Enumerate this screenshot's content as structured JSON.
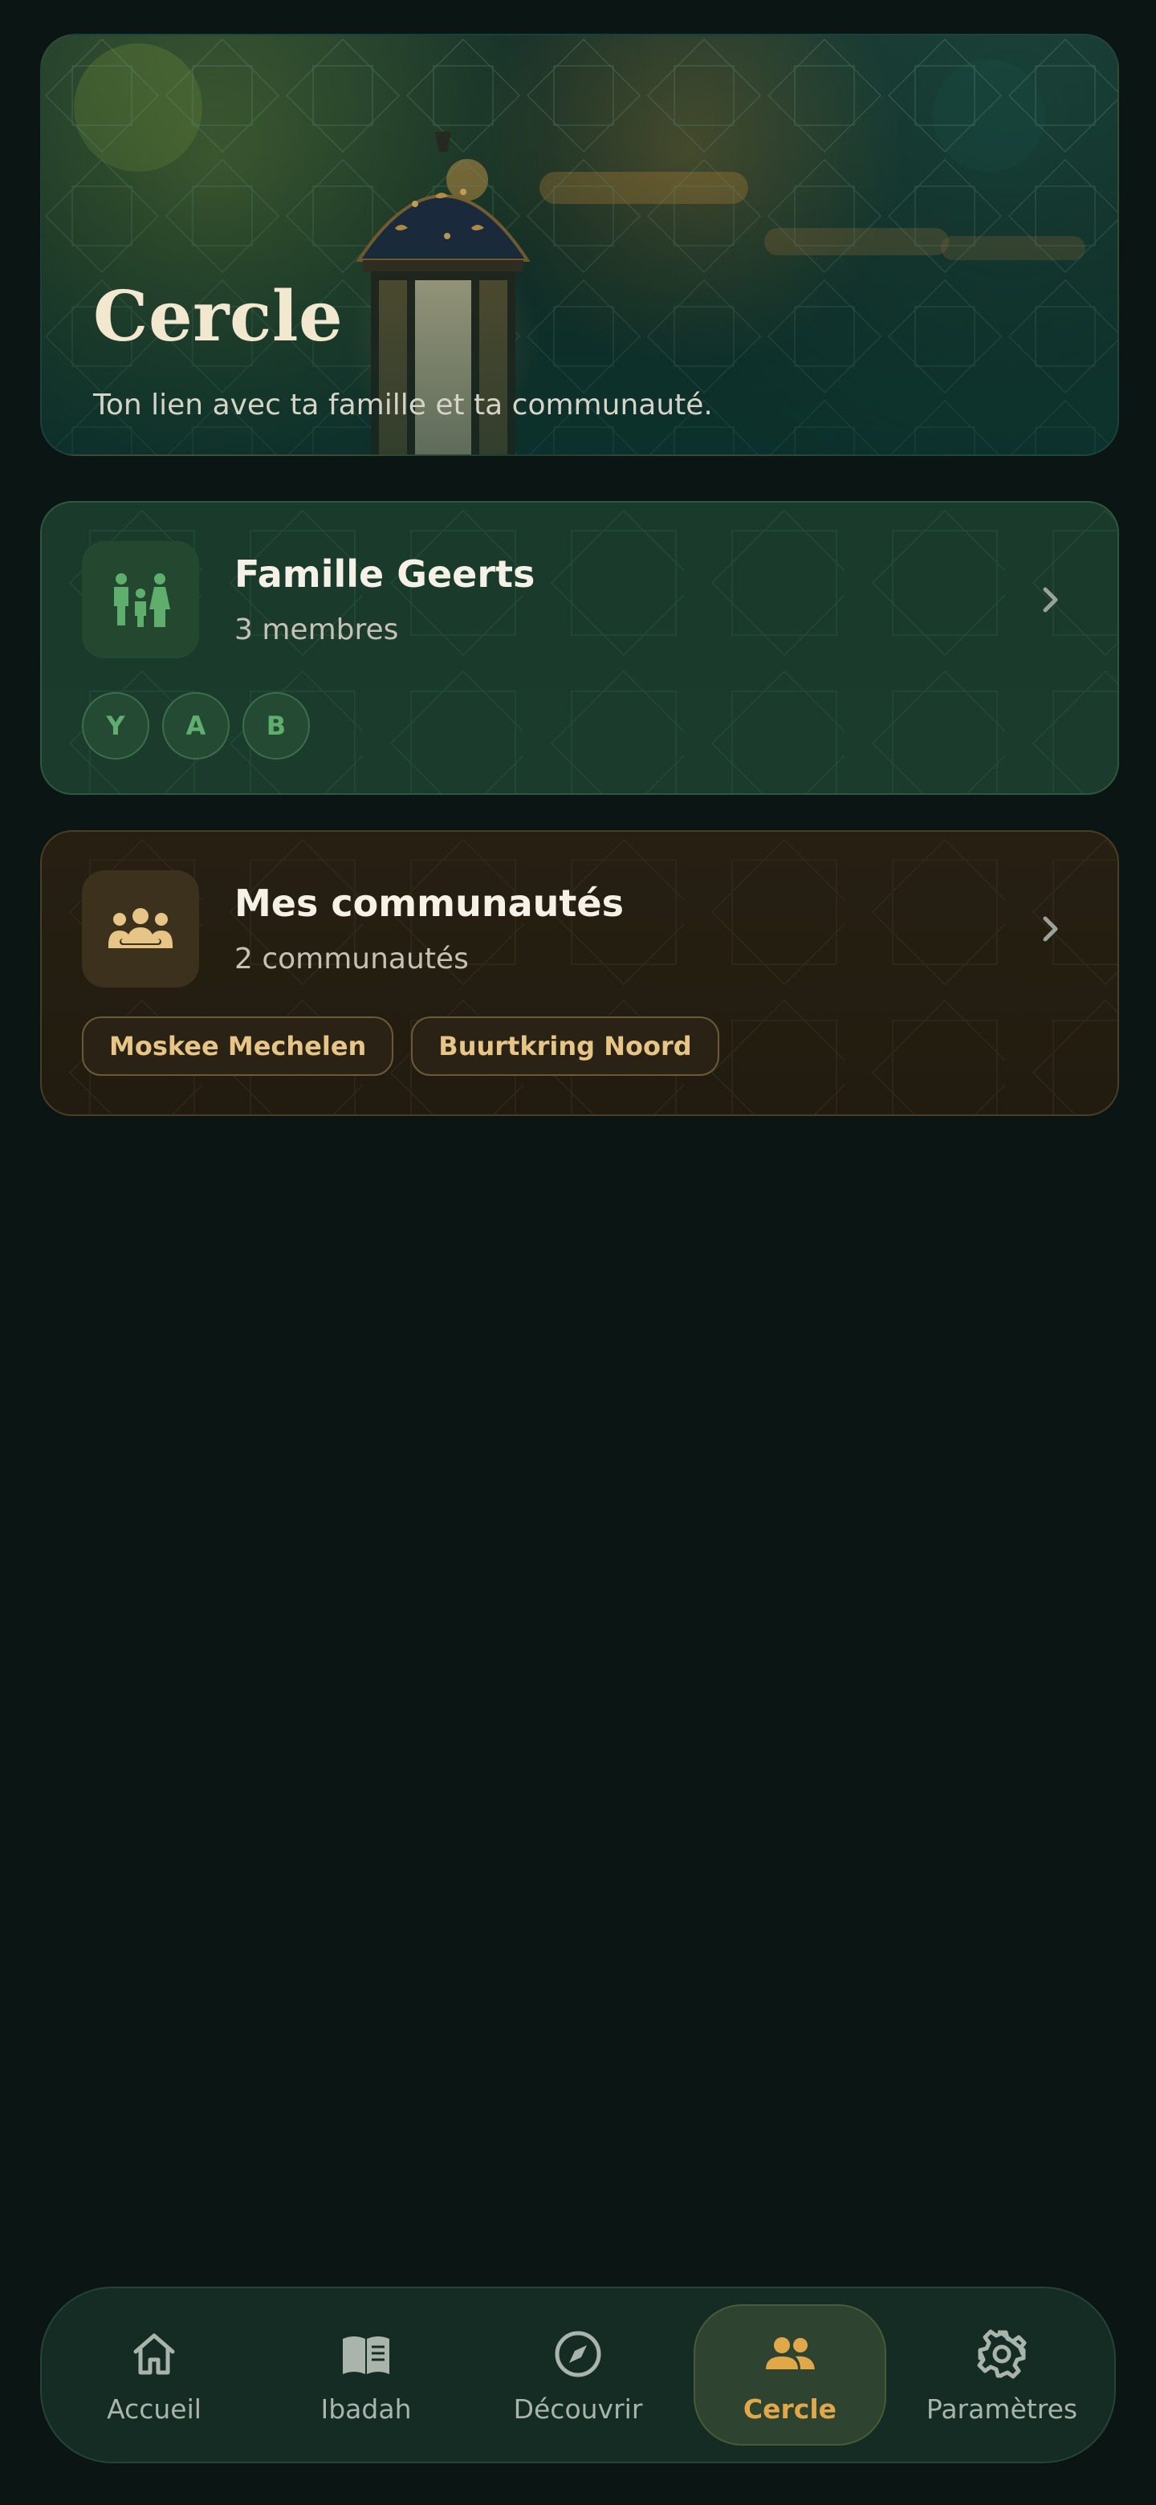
{
  "hero": {
    "title": "Cercle",
    "subtitle": "Ton lien avec ta famille et ta communauté."
  },
  "family_card": {
    "icon": "family-icon",
    "title": "Famille Geerts",
    "subtitle": "3 membres",
    "members": [
      "Y",
      "A",
      "B"
    ]
  },
  "community_card": {
    "icon": "community-icon",
    "title": "Mes communautés",
    "subtitle": "2 communautés",
    "tags": [
      "Moskee Mechelen",
      "Buurtkring Noord"
    ]
  },
  "bottom_nav": {
    "items": [
      {
        "label": "Accueil",
        "icon": "home-icon"
      },
      {
        "label": "Ibadah",
        "icon": "book-icon"
      },
      {
        "label": "Découvrir",
        "icon": "compass-icon"
      },
      {
        "label": "Cercle",
        "icon": "people-icon",
        "active": true
      },
      {
        "label": "Paramètres",
        "icon": "gear-icon"
      }
    ]
  },
  "colors": {
    "background": "#0b1614",
    "accent_gold": "#e0a849",
    "family_green": "#5fae6e",
    "nav_background": "#142c24"
  }
}
